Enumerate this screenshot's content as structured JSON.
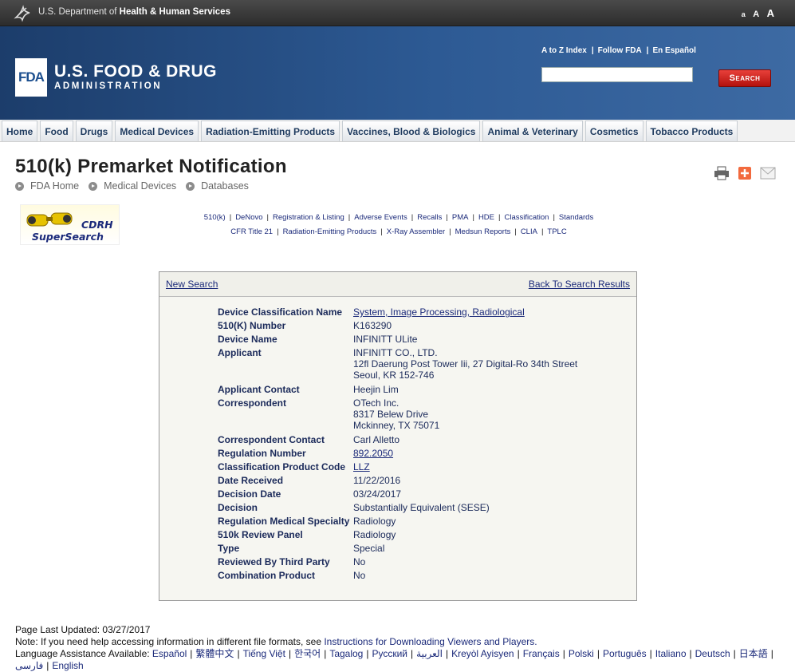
{
  "hhs": {
    "prefix": "U.S. Department of",
    "name": "Health & Human Services",
    "text_size": [
      "a",
      "A",
      "A"
    ]
  },
  "header": {
    "badge": "FDA",
    "name": "U.S. FOOD & DRUG",
    "sub": "ADMINISTRATION",
    "links": [
      "A to Z Index",
      "Follow FDA",
      "En Español"
    ],
    "search_placeholder": "",
    "search_button": "Search"
  },
  "nav": {
    "tabs": [
      "Home",
      "Food",
      "Drugs",
      "Medical Devices",
      "Radiation-Emitting Products",
      "Vaccines, Blood & Biologics",
      "Animal & Veterinary",
      "Cosmetics",
      "Tobacco Products"
    ]
  },
  "page": {
    "title": "510(k) Premarket Notification",
    "breadcrumb": [
      "FDA Home",
      "Medical Devices",
      "Databases"
    ]
  },
  "cdrh": {
    "line1": "CDRH",
    "line2": "SuperSearch"
  },
  "db_links": {
    "row1": [
      "510(k)",
      "DeNovo",
      "Registration & Listing",
      "Adverse Events",
      "Recalls",
      "PMA",
      "HDE",
      "Classification",
      "Standards"
    ],
    "row2": [
      "CFR Title 21",
      "Radiation-Emitting Products",
      "X-Ray Assembler",
      "Medsun Reports",
      "CLIA",
      "TPLC"
    ]
  },
  "panel": {
    "new_search": "New Search",
    "back_results": "Back To Search Results",
    "rows": [
      {
        "label": "Device Classification Name",
        "lines": [
          "System, Image Processing, Radiological"
        ],
        "link": true
      },
      {
        "label": "510(K) Number",
        "lines": [
          "K163290"
        ]
      },
      {
        "label": "Device Name",
        "lines": [
          "INFINITT ULite"
        ]
      },
      {
        "label": "Applicant",
        "lines": [
          "INFINITT CO., LTD.",
          "12fl Daerung Post Tower Iii, 27 Digital-Ro 34th Street",
          "Seoul,  KR 152-746"
        ]
      },
      {
        "label": "Applicant Contact",
        "lines": [
          "Heejin Lim"
        ]
      },
      {
        "label": "Correspondent",
        "lines": [
          "OTech Inc.",
          "8317 Belew Drive",
          "Mckinney,  TX  75071"
        ]
      },
      {
        "label": "Correspondent Contact",
        "lines": [
          "Carl Alletto"
        ]
      },
      {
        "label": "Regulation Number",
        "lines": [
          "892.2050"
        ],
        "link": true
      },
      {
        "label": "Classification Product Code",
        "lines": [
          "LLZ"
        ],
        "link": true
      },
      {
        "label": "Date Received",
        "lines": [
          "11/22/2016"
        ]
      },
      {
        "label": "Decision Date",
        "lines": [
          "03/24/2017"
        ]
      },
      {
        "label": "Decision",
        "lines": [
          "Substantially Equivalent (SESE)"
        ]
      },
      {
        "label": "Regulation Medical Specialty",
        "lines": [
          "Radiology"
        ]
      },
      {
        "label": "510k Review Panel",
        "lines": [
          "Radiology"
        ]
      },
      {
        "label": "Type",
        "lines": [
          "Special"
        ]
      },
      {
        "label": "Reviewed By Third Party",
        "lines": [
          "No"
        ]
      },
      {
        "label": "Combination Product",
        "lines": [
          "No"
        ]
      }
    ]
  },
  "footer": {
    "updated": "Page Last Updated: 03/27/2017",
    "note": "Note: If you need help accessing information in different file formats, see",
    "note_link": "Instructions for Downloading Viewers and Players.",
    "lang_prefix": "Language Assistance Available:",
    "languages": [
      "Español",
      "繁體中文",
      "Tiếng Việt",
      "한국어",
      "Tagalog",
      "Русский",
      "العربية",
      "Kreyòl Ayisyen",
      "Français",
      "Polski",
      "Português",
      "Italiano",
      "Deutsch",
      "日本語",
      "فارسی",
      "English"
    ]
  }
}
